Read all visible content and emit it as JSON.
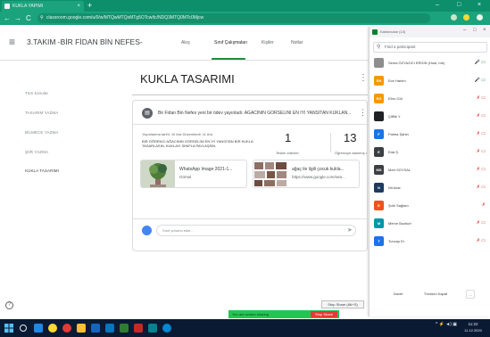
{
  "browser": {
    "tab_title": "KUKLA YAPIMI",
    "tab_close": "×",
    "new_tab": "+",
    "url": "classroom.google.com/u/0/w/MTQwMTQxMTg5OTcw/tc/NDQ3MTQ0MTc0Mjcw",
    "nav": {
      "back": "←",
      "forward": "→",
      "reload": "C",
      "lock": "⚲"
    },
    "window_controls": {
      "minimize": "–",
      "maximize": "□",
      "close": "×"
    }
  },
  "classroom": {
    "menu_icon": "≡",
    "class_title": "3.TAKIM -BİR FİDAN BİN NEFES-",
    "tabs": [
      "Akış",
      "Sınıf Çalışmaları",
      "Kişiler",
      "Notlar"
    ],
    "active_tab_index": 1,
    "topics": [
      "Tüm konular",
      "TASARIM YAZMA",
      "BİLMECE YAZMA",
      "ŞİİR YAZMA",
      "KUKLA TASARIMI"
    ],
    "active_topic_index": 4,
    "section_title": "KUKLA TASARIMI",
    "section_menu": "⋮",
    "assignment": {
      "icon": "▤",
      "title": "Bir Fidan Bin Nefes yeni bir ödev yayınladı: AĞACININ GÖRSELİNİ EN İYİ YANSITAN KUKLAN...",
      "menu": "⋮",
      "posted": "Yayınlanma tarihi: 10 Ara   Düzenlendi: 11 Ara",
      "description": "BİR ÖĞRENCİ AĞACININ GÖRSELİNİ EN İYİ YANSITAN BİR KUKLA TASARLASIN, KUKLAYI SINIFLA PAYLAŞSIN.",
      "stat_turned_in_value": "1",
      "stat_turned_in_label": "Teslim edenler",
      "stat_assigned_value": "13",
      "stat_assigned_label": "Öğrenciye atanmış ödev",
      "attachments": [
        {
          "title": "WhatsApp Image 2021-1...",
          "subtitle": "Görsel"
        },
        {
          "title": "ağaç ile ilgili çocuk kukla...",
          "subtitle": "https://www.google.com/sea..."
        }
      ],
      "comment_placeholder": "Sınıf yorumu ekle...",
      "send_icon": "➤"
    },
    "help_icon": "?"
  },
  "meet": {
    "title": "Katılımcılar (13)",
    "search_placeholder": "Find a participant",
    "participants": [
      {
        "initials": "",
        "name": "Sema ÖZYAZICI ERGİN (Host, me)",
        "icons": "🎤 ▭",
        "color": "#8e8e8e",
        "ok": true
      },
      {
        "initials": "EH",
        "name": "Ece Hanim",
        "icons": "🎤 ▭",
        "color": "#f29900",
        "ok": true
      },
      {
        "initials": "EG",
        "name": "Ebru Gül",
        "icons": "✗ ▭",
        "color": "#f29900",
        "ok": false
      },
      {
        "initials": "",
        "name": "Çiftlik Y",
        "icons": "✗ ▭",
        "color": "#202124",
        "ok": false
      },
      {
        "initials": "F",
        "name": "Fatma Şahin",
        "icons": "✗ ▭",
        "color": "#1a73e8",
        "ok": false
      },
      {
        "initials": "E",
        "name": "Eda Ş.",
        "icons": "✗ ▭",
        "color": "#3c4043",
        "ok": false
      },
      {
        "initials": "MS",
        "name": "Mert SOYSAL",
        "icons": "✗ ▭",
        "color": "#3c4043",
        "ok": false
      },
      {
        "initials": "N",
        "name": "Nil Acar",
        "icons": "✗ ▭",
        "color": "#1e3a5f",
        "ok": false
      },
      {
        "initials": "E",
        "name": "Şule Sağlam",
        "icons": "✗",
        "color": "#f4511e",
        "ok": false
      },
      {
        "initials": "M",
        "name": "Merve Bozkurt",
        "icons": "✗ ▭",
        "color": "#0097a7",
        "ok": false
      },
      {
        "initials": "T",
        "name": "Tuncay Er",
        "icons": "✗ ▭",
        "color": "#1a73e8",
        "ok": false
      }
    ],
    "buttons": [
      "Davet",
      "Tümünü Kapat",
      "..."
    ]
  },
  "screen_share": {
    "tooltip": "Stop Share (Alt+S)",
    "status": "You are screen sharing",
    "stop_label": "Stop Share"
  },
  "taskbar": {
    "tray_time": "11:22",
    "tray_date": "11.12.2020",
    "tray_icons": "^ ⚡ ◄) ▣"
  }
}
